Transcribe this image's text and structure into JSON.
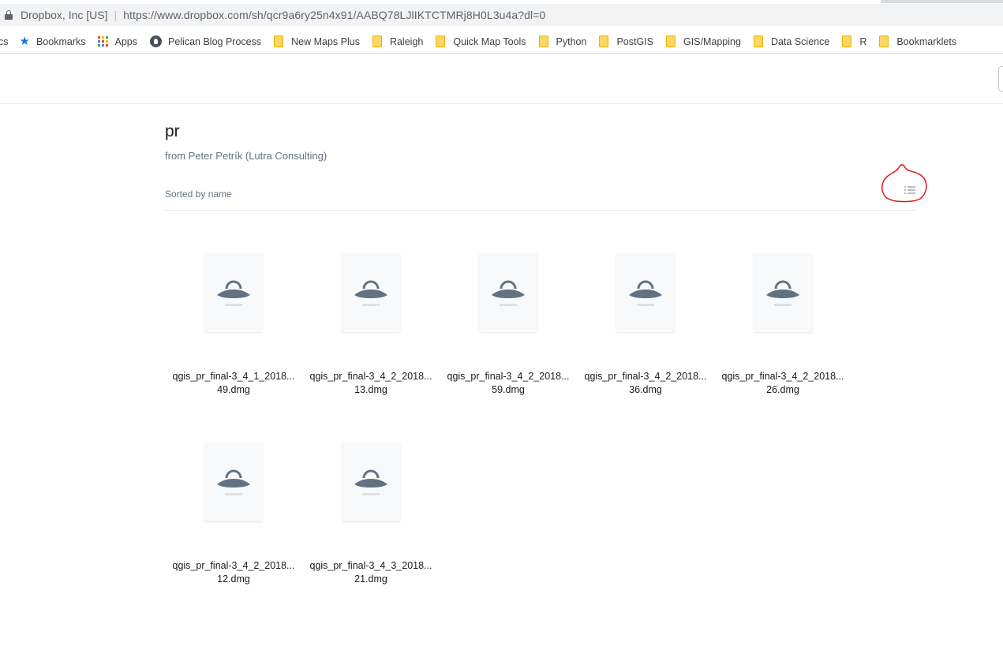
{
  "browser": {
    "site_identity": "Dropbox, Inc [US]",
    "separator": "|",
    "url": "https://www.dropbox.com/sh/qcr9a6ry25n4x91/AABQ78LJlIKTCTMRj8H0L3u4a?dl=0"
  },
  "bookmarks": {
    "clipped_label": "cs",
    "items": [
      {
        "label": "Bookmarks",
        "icon": "star-icon"
      },
      {
        "label": "Apps",
        "icon": "apps-grid-icon"
      },
      {
        "label": "Pelican Blog Process",
        "icon": "pelican-icon"
      },
      {
        "label": "New Maps Plus",
        "icon": "folder-icon"
      },
      {
        "label": "Raleigh",
        "icon": "folder-icon"
      },
      {
        "label": "Quick Map Tools",
        "icon": "folder-icon"
      },
      {
        "label": "Python",
        "icon": "folder-icon"
      },
      {
        "label": "PostGIS",
        "icon": "folder-icon"
      },
      {
        "label": "GIS/Mapping",
        "icon": "folder-icon"
      },
      {
        "label": "Data Science",
        "icon": "folder-icon"
      },
      {
        "label": "R",
        "icon": "folder-icon"
      },
      {
        "label": "Bookmarklets",
        "icon": "folder-icon"
      }
    ]
  },
  "folder": {
    "title": "pr",
    "owner": "from Peter Petrík (Lutra Consulting)",
    "sort_label": "Sorted by name",
    "view_toggle_icon": "list-view-icon"
  },
  "files": [
    {
      "name_line1": "qgis_pr_final-3_4_1_2018...",
      "name_line2": "49.dmg",
      "icon": "package-icon"
    },
    {
      "name_line1": "qgis_pr_final-3_4_2_2018...",
      "name_line2": "13.dmg",
      "icon": "package-icon"
    },
    {
      "name_line1": "qgis_pr_final-3_4_2_2018...",
      "name_line2": "59.dmg",
      "icon": "package-icon"
    },
    {
      "name_line1": "qgis_pr_final-3_4_2_2018...",
      "name_line2": "36.dmg",
      "icon": "package-icon"
    },
    {
      "name_line1": "qgis_pr_final-3_4_2_2018...",
      "name_line2": "26.dmg",
      "icon": "package-icon"
    },
    {
      "name_line1": "qgis_pr_final-3_4_2_2018...",
      "name_line2": "12.dmg",
      "icon": "package-icon"
    },
    {
      "name_line1": "qgis_pr_final-3_4_3_2018...",
      "name_line2": "21.dmg",
      "icon": "package-icon"
    }
  ],
  "colors": {
    "accent_blue": "#1a73e8",
    "package_icon": "#637282",
    "annotation_red": "#e0151c",
    "folder_yellow": "#fdd663"
  }
}
